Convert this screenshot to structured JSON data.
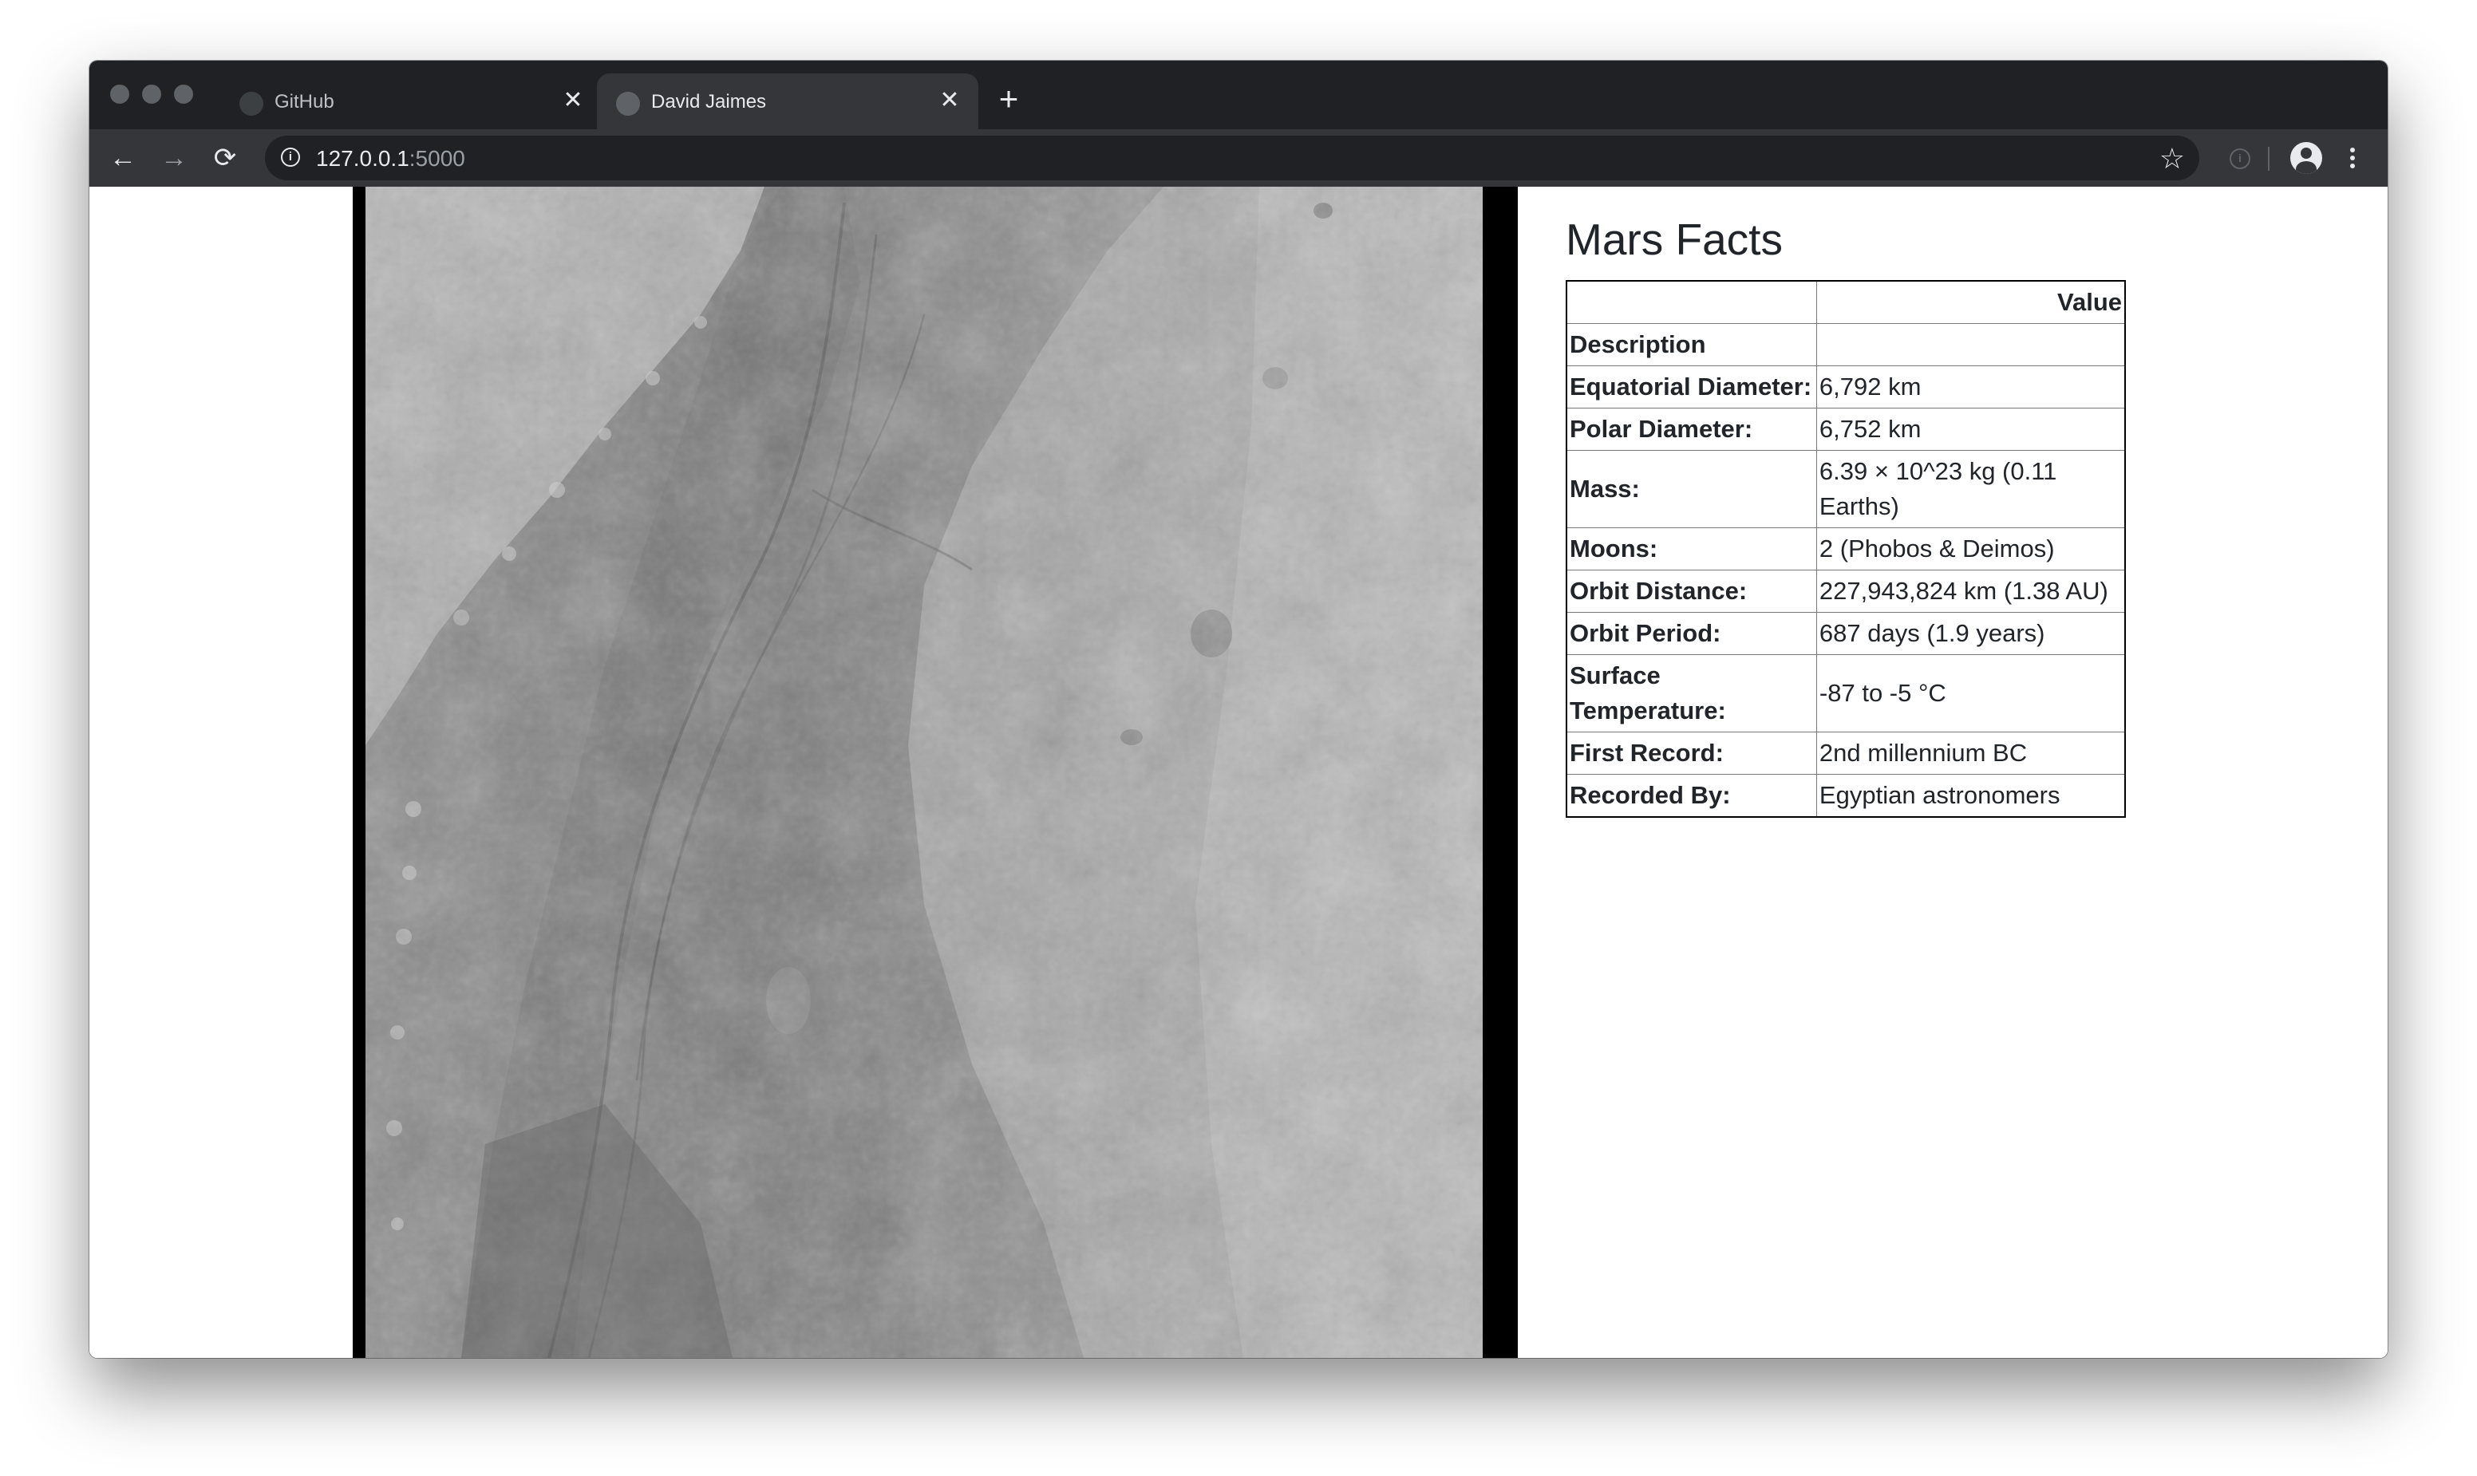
{
  "browser": {
    "tabs": [
      {
        "title": "GitHub",
        "close": "✕"
      },
      {
        "title": "David Jaimes",
        "close": "✕"
      }
    ],
    "new_tab": "+",
    "nav": {
      "back": "←",
      "forward": "→",
      "reload": "⟳"
    },
    "address": {
      "host": "127.0.0.1",
      "port": ":5000",
      "info": "i"
    },
    "bookmark": "☆",
    "extension": "i"
  },
  "page": {
    "facts_title": "Mars Facts",
    "table": {
      "header": [
        "",
        "Value"
      ],
      "rows": [
        {
          "label": "Description",
          "value": ""
        },
        {
          "label": "Equatorial Diameter:",
          "value": "6,792 km"
        },
        {
          "label": "Polar Diameter:",
          "value": "6,752 km"
        },
        {
          "label": "Mass:",
          "value": "6.39 × 10^23 kg (0.11 Earths)"
        },
        {
          "label": "Moons:",
          "value": "2 (Phobos & Deimos)"
        },
        {
          "label": "Orbit Distance:",
          "value": "227,943,824 km (1.38 AU)"
        },
        {
          "label": "Orbit Period:",
          "value": "687 days (1.9 years)"
        },
        {
          "label": "Surface Temperature:",
          "value": "-87 to -5 °C"
        },
        {
          "label": "First Record:",
          "value": "2nd millennium BC"
        },
        {
          "label": "Recorded By:",
          "value": "Egyptian astronomers"
        }
      ]
    }
  }
}
